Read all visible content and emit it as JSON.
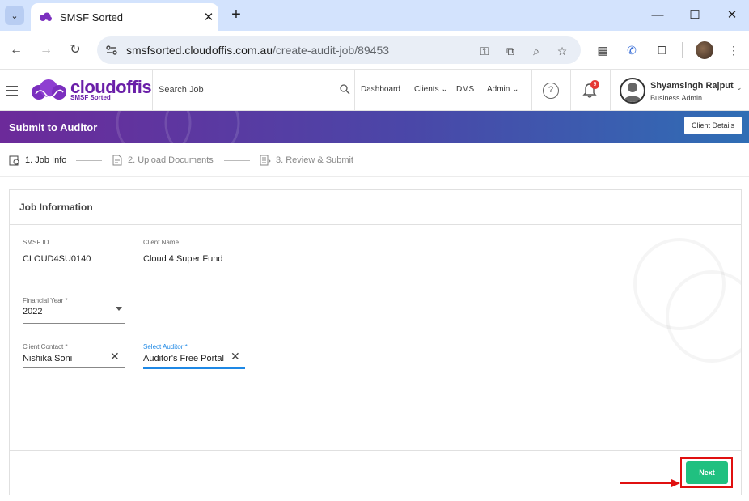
{
  "browser": {
    "tab_title": "SMSF Sorted",
    "tab_close": "✕",
    "new_tab": "+",
    "url_domain": "smsfsorted.cloudoffis.com.au",
    "url_path": "/create-audit-job/89453",
    "window_minimize": "—",
    "window_maximize": "☐",
    "window_close": "✕"
  },
  "header": {
    "logo_text": "cloudoffis",
    "logo_sub": "SMSF Sorted",
    "search_placeholder": "Search Job",
    "nav": {
      "dashboard": "Dashboard",
      "clients": "Clients",
      "dms": "DMS",
      "admin": "Admin"
    },
    "help_glyph": "?",
    "notification_count": "9",
    "user_name": "Shyamsingh Rajput",
    "user_role": "Business Admin"
  },
  "banner": {
    "title": "Submit to Auditor",
    "client_details_label": "Client Details"
  },
  "stepper": {
    "steps": [
      {
        "label": "1. Job Info",
        "active": true
      },
      {
        "label": "2. Upload Documents",
        "active": false
      },
      {
        "label": "3. Review & Submit",
        "active": false
      }
    ]
  },
  "card": {
    "title": "Job Information",
    "smsf_id_label": "SMSF ID",
    "smsf_id_value": "CLOUD4SU0140",
    "client_name_label": "Client Name",
    "client_name_value": "Cloud 4 Super Fund",
    "financial_year_label": "Financial Year *",
    "financial_year_value": "2022",
    "client_contact_label": "Client Contact *",
    "client_contact_value": "Nishika Soni",
    "auditor_label": "Select Auditor *",
    "auditor_value": "Auditor's Free Portal",
    "clear_glyph": "✕"
  },
  "footer": {
    "next_label": "Next"
  },
  "colors": {
    "brand_purple": "#6a1fa8",
    "next_green": "#20c080",
    "highlight_red": "#e01010",
    "active_blue": "#1e88e5"
  }
}
